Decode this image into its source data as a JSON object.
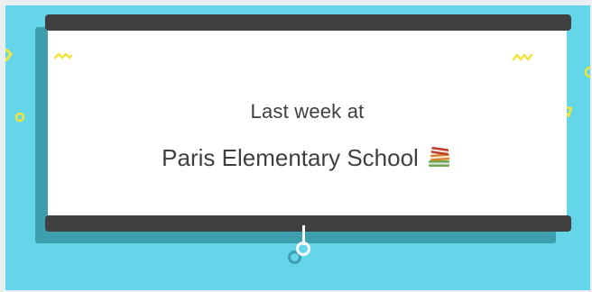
{
  "banner": {
    "line1": "Last week at",
    "line2": "Paris Elementary School",
    "icon": "books-icon"
  },
  "colors": {
    "background": "#65d6ea",
    "screen_roller": "#404040",
    "screen_shadow": "#3d9eae",
    "screen": "#ffffff",
    "decoration": "#f3e33a",
    "text": "#3f3f3f"
  }
}
